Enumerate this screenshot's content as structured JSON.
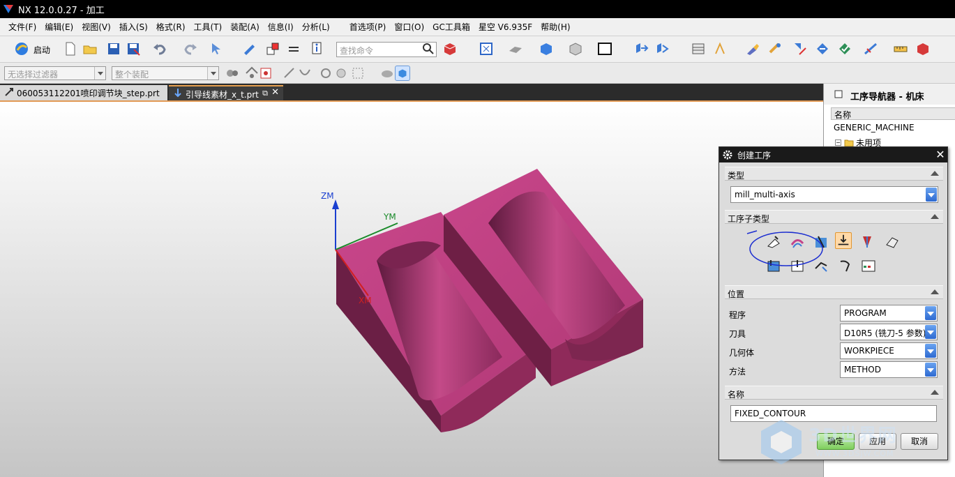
{
  "window": {
    "title": "NX 12.0.0.27 - 加工"
  },
  "menu": [
    "文件(F)",
    "编辑(E)",
    "视图(V)",
    "插入(S)",
    "格式(R)",
    "工具(T)",
    "装配(A)",
    "信息(I)",
    "分析(L)",
    "首选项(P)",
    "窗口(O)",
    "GC工具箱",
    "星空 V6.935F",
    "帮助(H)"
  ],
  "toolbar": {
    "start_label": "启动",
    "search_placeholder": "查找命令"
  },
  "selection_bar": {
    "filter": "无选择过滤器",
    "scope": "整个装配"
  },
  "tabs": [
    {
      "label": "060053112201喷印调节块_step.prt"
    },
    {
      "label": "引导线素材_x_t.prt"
    }
  ],
  "viewport": {
    "axes": {
      "z": "ZM",
      "y": "YM",
      "x": "XM"
    },
    "colors": {
      "part_top": "#c2417f",
      "part_side": "#8f2a5a",
      "part_front": "#6e1f45",
      "bg_top": "#ffffff",
      "bg_bottom": "#c5c5c5"
    }
  },
  "navigator": {
    "title": "工序导航器 - 机床",
    "column": "名称",
    "rows": [
      "GENERIC_MACHINE",
      "未用项"
    ]
  },
  "dialog": {
    "title": "创建工序",
    "type_section": "类型",
    "type_value": "mill_multi-axis",
    "subtype_section": "工序子类型",
    "position_section": "位置",
    "program_label": "程序",
    "program_value": "PROGRAM",
    "tool_label": "刀具",
    "tool_value": "D10R5 (铣刀-5 参数)",
    "geometry_label": "几何体",
    "geometry_value": "WORKPIECE",
    "method_label": "方法",
    "method_value": "METHOD",
    "name_section": "名称",
    "name_value": "FIXED_CONTOUR",
    "ok": "确定",
    "apply": "应用",
    "cancel": "取消"
  },
  "watermark": {
    "brand": "3D世界网",
    "url": "WWW.3DSJW.COM"
  }
}
